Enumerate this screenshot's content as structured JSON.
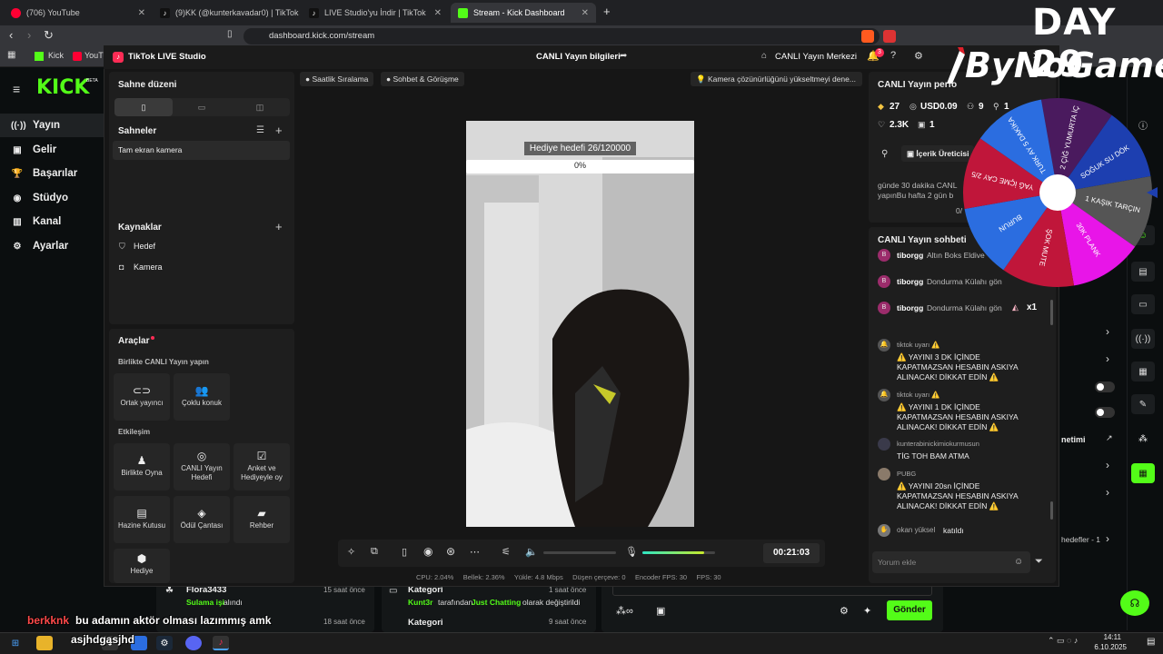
{
  "browser": {
    "tabs": [
      {
        "title": "(706) YouTube",
        "color": "#ff0033"
      },
      {
        "title": "(9)KK (@kunterkavadar0) | TikTok",
        "color": "#ffffff"
      },
      {
        "title": "LIVE Studio'yu İndir | TikTok",
        "color": "#ffffff"
      },
      {
        "title": "Stream - Kick Dashboard",
        "color": "#53fc18"
      }
    ],
    "url": "dashboard.kick.com/stream",
    "bookmarks": [
      "Kick",
      "YouTu"
    ]
  },
  "kick": {
    "logo": "KICK",
    "logo_badge": "BETA",
    "nav": [
      {
        "label": "Yayın",
        "icon": "broadcast-icon"
      },
      {
        "label": "Gelir",
        "icon": "wallet-icon"
      },
      {
        "label": "Başarılar",
        "icon": "trophy-icon"
      },
      {
        "label": "Stüdyo",
        "icon": "studio-icon"
      },
      {
        "label": "Kanal",
        "icon": "chart-icon"
      },
      {
        "label": "Ayarlar",
        "icon": "gear-icon"
      }
    ],
    "activity": [
      {
        "user": "Flora3433",
        "time": "15 saat önce",
        "action": "Sulama işi",
        "suffix": "alındı"
      },
      {
        "user": "",
        "time": "18 saat önce",
        "action": "",
        "suffix": ""
      }
    ],
    "category_events": [
      {
        "title": "Kategori",
        "time": "1 saat önce",
        "user": "Kunt3r",
        "mid": "tarafından",
        "category": "Just Chatting",
        "suffix": "olarak değiştirildi"
      },
      {
        "title": "Kategori",
        "time": "9 saat önce"
      }
    ],
    "send_button": "Gönder",
    "right_labels": {
      "management": "netimi",
      "goals": "hedefler - 1"
    },
    "accent": "#53fc18"
  },
  "tiktok": {
    "app_title": "TikTok LIVE Studio",
    "header_center": "CANLI Yayın bilgileri",
    "header_right": "CANLI Yayın Merkezi",
    "notif_count": "3",
    "scene": {
      "title": "Sahne düzeni",
      "scenes_title": "Sahneler",
      "scene_item": "Tam ekran kamera",
      "sources_title": "Kaynaklar",
      "sources": [
        "Hedef",
        "Kamera"
      ]
    },
    "tools": {
      "title": "Araçlar",
      "section1": "Birlikte CANLI Yayın yapın",
      "items1": [
        "Ortak yayıncı",
        "Çoklu konuk"
      ],
      "section2": "Etkileşim",
      "items2": [
        "Birlikte Oyna",
        "CANLI Yayın Hedefi",
        "Anket ve Hediyeyle oy",
        "Hazine Kutusu",
        "Ödül Çantası",
        "Rehber",
        "Hediye"
      ]
    },
    "chips": {
      "left1": "Saatlik Sıralama",
      "left2": "Sohbet & Görüşme",
      "right": "Kamera çözünürlüğünü yükseltmeyi dene..."
    },
    "gift_goal": {
      "label": "Hediye hedefi",
      "current": 26,
      "target": 120000,
      "text": "26/120000",
      "percent_text": "0%",
      "percent": 0
    },
    "controls": {
      "timer": "00:21:03",
      "mic_level": 0.85
    },
    "stats": {
      "cpu_label": "CPU:",
      "cpu": "2.04%",
      "mem_label": "Bellek:",
      "mem": "2.36%",
      "up_label": "Yükle:",
      "up": "4.8 Mbps",
      "drop_label": "Düşen çerçeve:",
      "drop": "0",
      "enc_label": "Encoder FPS:",
      "enc": "30",
      "fps_label": "FPS:",
      "fps": "30"
    },
    "perf": {
      "title": "CANLI Yayın perfo",
      "diamonds": "27",
      "usd": "USD0.09",
      "viewers": "9",
      "extra": "1",
      "likes": "2.3K",
      "shares": "1",
      "creator_btn": "İçerik Üreticisi",
      "note1": "günde 30 dakika CANL",
      "note2": "yapınBu hafta 2 gün b",
      "progress": "0/"
    },
    "chat": {
      "title": "CANLI Yayın sohbeti",
      "gifts": [
        {
          "user": "tiborgg",
          "text": "Altın Boks Eldive",
          "count": ""
        },
        {
          "user": "tiborgg",
          "text": "Dondurma Külahı gön",
          "count": ""
        },
        {
          "user": "tiborgg",
          "text": "Dondurma Külahı gön",
          "count": "x1"
        }
      ],
      "messages": [
        {
          "user": "tiktok uyarı ⚠️",
          "text": "⚠️ YAYINI 3 DK İÇİNDE KAPATMAZSAN HESABIN ASKIYA ALINACAK! DİKKAT EDİN ⚠️"
        },
        {
          "user": "tiktok uyarı ⚠️",
          "text": "⚠️ YAYINI 1 DK İÇİNDE KAPATMAZSAN HESABIN ASKIYA ALINACAK! DİKKAT EDİN ⚠️"
        },
        {
          "user": "kunterabinickimiokurmusun",
          "text": "TİG TOH BAM ATMA"
        },
        {
          "user": "PUBG",
          "text": "⚠️ YAYINI 20sn İÇİNDE KAPATMAZSAN HESABIN ASKIYA ALINACAK! DİKKAT EDİN ⚠️"
        }
      ],
      "join": {
        "user": "okan yüksel",
        "text": "katıldı"
      },
      "input_placeholder": "Yorum ekle"
    }
  },
  "overlay": {
    "day": "DAY 29",
    "brand": "ByNoGame",
    "chat_user": "berkknk",
    "chat_text": "bu adamın aktör olması lazımmış amk",
    "chat_user2": "asjhdgasjhd",
    "wheel": [
      {
        "label": "2 ÇİĞ YUMURTA İÇ",
        "color": "#4a1a5e"
      },
      {
        "label": "SOĞUK SU DÖK",
        "color": "#1d3fb0"
      },
      {
        "label": "1 KAŞIK TARÇIN",
        "color": "#555555"
      },
      {
        "label": "30K PLANK",
        "color": "#e815e8"
      },
      {
        "label": "ŞOK MUTE",
        "color": "#c0163a"
      },
      {
        "label": "BURUN",
        "color": "#2b6de0"
      },
      {
        "label": "YAĞ İÇME CAY 2/5",
        "color": "#c0163a"
      },
      {
        "label": "TURK AY 5 DAKİKA",
        "color": "#2b6de0"
      }
    ]
  },
  "taskbar": {
    "time": "14:11",
    "date": "6.10.2025"
  }
}
